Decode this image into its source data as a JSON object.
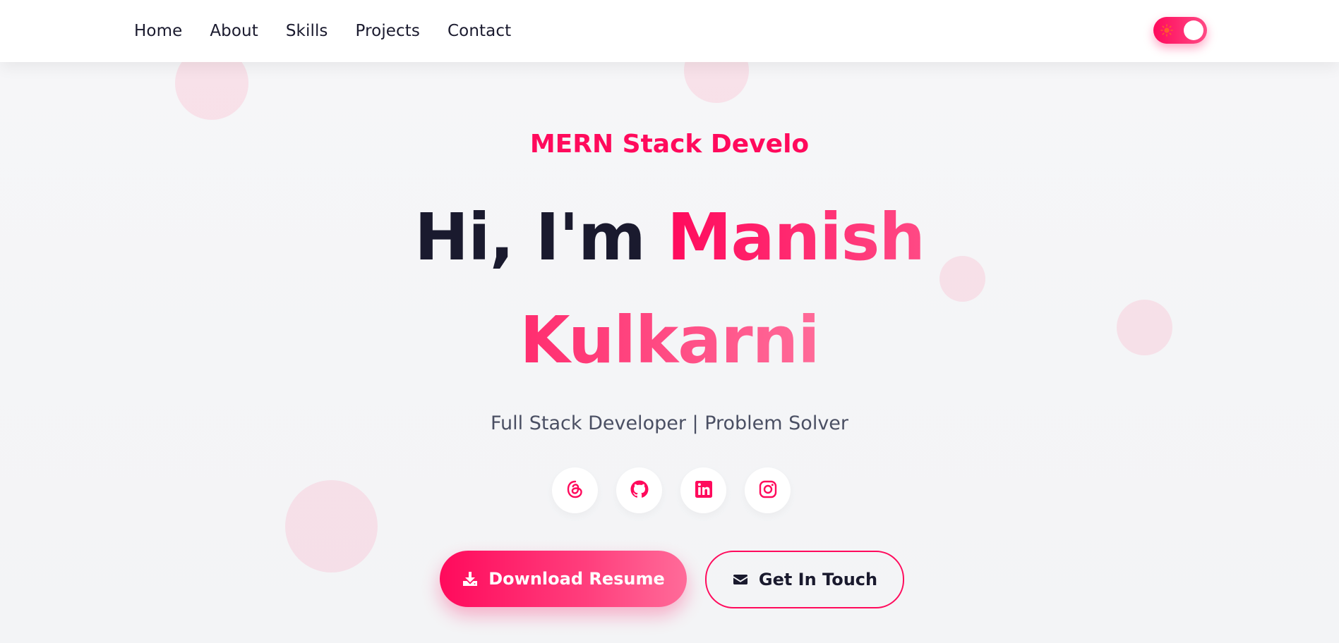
{
  "nav": {
    "items": [
      {
        "label": "Home"
      },
      {
        "label": "About"
      },
      {
        "label": "Skills"
      },
      {
        "label": "Projects"
      },
      {
        "label": "Contact"
      }
    ],
    "theme_toggle": {
      "icon": "sun-icon",
      "state": "on"
    }
  },
  "hero": {
    "role_text": "MERN Stack Develo",
    "greeting": "Hi, I'm",
    "first_name": "Manish",
    "last_name": "Kulkarni",
    "tagline": "Full Stack Developer | Problem Solver"
  },
  "socials": [
    {
      "icon": "threads-icon"
    },
    {
      "icon": "github-icon"
    },
    {
      "icon": "linkedin-icon"
    },
    {
      "icon": "instagram-icon"
    }
  ],
  "buttons": {
    "download_label": "Download Resume",
    "download_icon": "download-icon",
    "contact_label": "Get In Touch",
    "contact_icon": "envelope-icon"
  },
  "colors": {
    "accent": "#ff0a5c",
    "accent_light": "#ff6b99",
    "text_dark": "#1a1a2e",
    "text_muted": "#4a4f63",
    "background": "#f5f5f7"
  }
}
